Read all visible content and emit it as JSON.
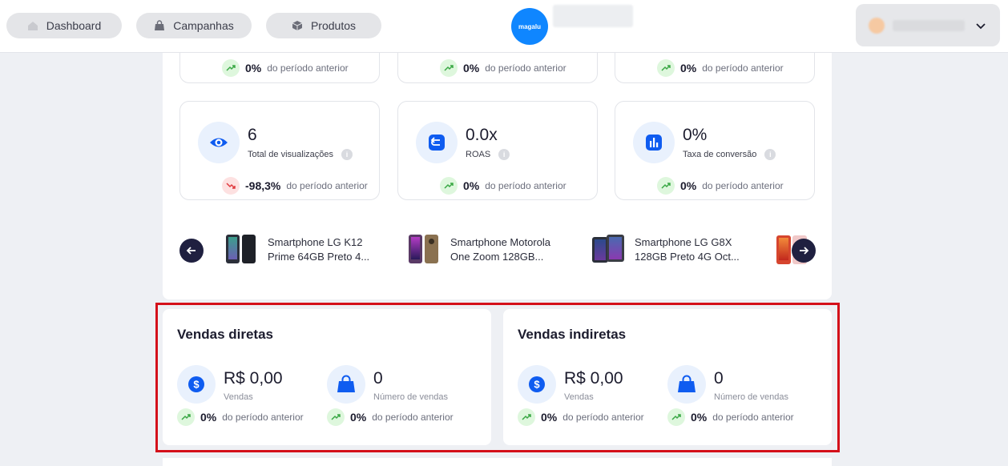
{
  "nav": {
    "dashboard": "Dashboard",
    "campaigns": "Campanhas",
    "products": "Produtos"
  },
  "brand": {
    "logo_text": "magalu"
  },
  "colors": {
    "accent": "#0f5cf0",
    "positive_bg": "#def7dd",
    "negative_bg": "#fde1e1",
    "highlight_border": "#d4101a",
    "logo_blue": "#0f86ff"
  },
  "top_cards": [
    {
      "value": "0%",
      "text": "do período anterior"
    },
    {
      "value": "0%",
      "text": "do período anterior"
    },
    {
      "value": "0%",
      "text": "do período anterior"
    }
  ],
  "metric_cards": [
    {
      "icon": "eye-icon",
      "value": "6",
      "label": "Total de visualizações",
      "trend_value": "-98,3%",
      "trend_text": "do período anterior",
      "trend": "down"
    },
    {
      "icon": "roas-icon",
      "value": "0.0x",
      "label": "ROAS",
      "trend_value": "0%",
      "trend_text": "do período anterior",
      "trend": "up"
    },
    {
      "icon": "bar-chart-icon",
      "value": "0%",
      "label": "Taxa de conversão",
      "trend_value": "0%",
      "trend_text": "do período anterior",
      "trend": "up"
    }
  ],
  "products": [
    {
      "name": "Smartphone LG K12 Prime 64GB Preto 4..."
    },
    {
      "name": "Smartphone Motorola One Zoom 128GB..."
    },
    {
      "name": "Smartphone LG G8X 128GB Preto 4G Oct..."
    }
  ],
  "sales": [
    {
      "title": "Vendas diretas",
      "revenue": "R$ 0,00",
      "revenue_label": "Vendas",
      "revenue_trend": "0%",
      "count": "0",
      "count_label": "Número de vendas",
      "count_trend": "0%",
      "trend_text": "do período anterior"
    },
    {
      "title": "Vendas indiretas",
      "revenue": "R$ 0,00",
      "revenue_label": "Vendas",
      "revenue_trend": "0%",
      "count": "0",
      "count_label": "Número de vendas",
      "count_trend": "0%",
      "trend_text": "do período anterior"
    }
  ]
}
